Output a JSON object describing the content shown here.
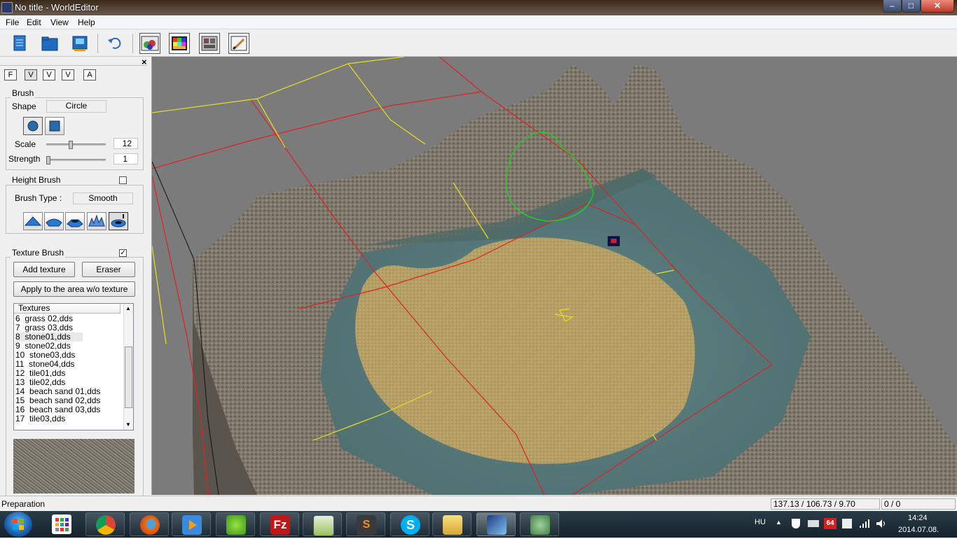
{
  "window": {
    "title": "No title - WorldEditor",
    "minimize": "–",
    "maximize": "□",
    "close": "✕"
  },
  "menu": [
    "File",
    "Edit",
    "View",
    "Help"
  ],
  "toolbar": {
    "buttons": [
      "new-file-icon",
      "open-folder-icon",
      "save-icon",
      "undo-icon",
      "terrain-view-icon",
      "texture-palette-icon",
      "object-grid-icon",
      "paint-brush-icon"
    ]
  },
  "panel": {
    "close": "×",
    "tabs": [
      "F",
      "V",
      "V",
      "V",
      "A"
    ],
    "brush": {
      "label": "Brush",
      "shape_label": "Shape",
      "shape_value": "Circle",
      "scale_label": "Scale",
      "scale_value": "12",
      "scale_fraction": 0.4,
      "strength_label": "Strength",
      "strength_value": "1",
      "strength_fraction": 0.0
    },
    "height_brush": {
      "label": "Height Brush",
      "checked": false,
      "type_label": "Brush Type :",
      "type_value": "Smooth"
    },
    "texture_brush": {
      "label": "Texture Brush",
      "checked": true,
      "add_texture": "Add texture",
      "eraser": "Eraser",
      "apply_area": "Apply to the area w/o texture",
      "list_header": "Textures",
      "items": [
        "6  grass 02,dds",
        "7  grass 03,dds",
        "8  stone01,dds",
        "9  stone02,dds",
        "10  stone03,dds",
        "11  stone04,dds",
        "12  tile01,dds",
        "13  tile02,dds",
        "14  beach sand 01,dds",
        "15  beach sand 02,dds",
        "16  beach sand 03,dds",
        "17  tile03,dds"
      ],
      "selected_index": 2
    }
  },
  "status": {
    "mode": "Preparation",
    "coords": "137.13 / 106.73 / 9.70",
    "count": "0 / 0"
  },
  "taskbar": {
    "apps": [
      "chrome-icon",
      "firefox-icon",
      "media-player-icon",
      "leaf-app-icon",
      "filezilla-icon",
      "notepad-icon",
      "sublime-icon",
      "skype-icon",
      "file-explorer-icon",
      "worldeditor-icon",
      "turtle-app-icon"
    ],
    "language": "HU",
    "badge": "64",
    "time": "14:24",
    "date": "2014.07.08."
  },
  "colors": {
    "terrain": "#837b6e",
    "water": "#5b7f80",
    "sand": "#b29d63",
    "grid_red": "#e02020",
    "grid_yellow": "#e8e020",
    "brush_ring": "#22cc22"
  }
}
